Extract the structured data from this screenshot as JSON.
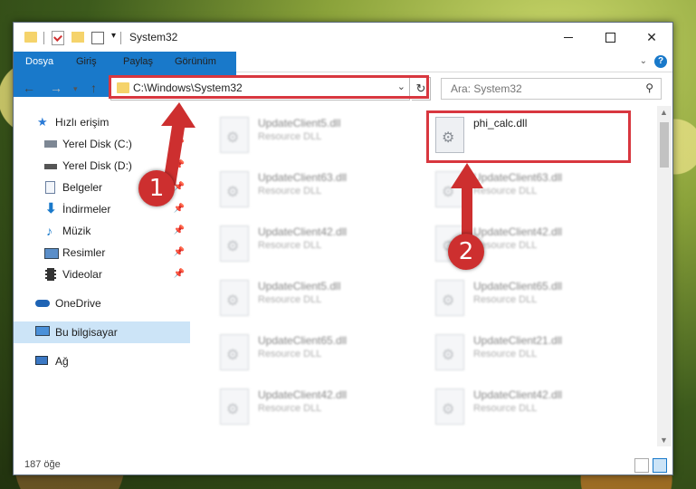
{
  "window": {
    "title": "System32"
  },
  "ribbon": {
    "tabs": [
      "Dosya",
      "Giriş",
      "Paylaş",
      "Görünüm"
    ],
    "help": "?"
  },
  "address": {
    "path": "C:\\Windows\\System32"
  },
  "search": {
    "placeholder": "Ara: System32"
  },
  "sidebar": {
    "items": [
      {
        "label": "Hızlı erişim",
        "icon": "star-icon"
      },
      {
        "label": "Yerel Disk (C:)",
        "icon": "drive-icon",
        "pinned": true
      },
      {
        "label": "Yerel Disk (D:)",
        "icon": "drive-icon",
        "pinned": true
      },
      {
        "label": "Belgeler",
        "icon": "document-icon",
        "pinned": true
      },
      {
        "label": "İndirmeler",
        "icon": "download-icon",
        "pinned": true
      },
      {
        "label": "Müzik",
        "icon": "music-icon",
        "pinned": true
      },
      {
        "label": "Resimler",
        "icon": "pictures-icon",
        "pinned": true
      },
      {
        "label": "Videolar",
        "icon": "videos-icon",
        "pinned": true
      },
      {
        "label": "OneDrive",
        "icon": "cloud-icon"
      },
      {
        "label": "Bu bilgisayar",
        "icon": "computer-icon",
        "selected": true
      },
      {
        "label": "Ağ",
        "icon": "network-icon"
      }
    ]
  },
  "files": {
    "left": [
      {
        "name": "UpdateClient5.dll",
        "type": "Resource DLL"
      },
      {
        "name": "UpdateClient63.dll",
        "type": "Resource DLL"
      },
      {
        "name": "UpdateClient42.dll",
        "type": "Resource DLL"
      },
      {
        "name": "UpdateClient5.dll",
        "type": "Resource DLL"
      },
      {
        "name": "UpdateClient65.dll",
        "type": "Resource DLL"
      },
      {
        "name": "UpdateClient42.dll",
        "type": "Resource DLL"
      }
    ],
    "right": [
      {
        "name": "phi_calc.dll",
        "type": ""
      },
      {
        "name": "UpdateClient63.dll",
        "type": "Resource DLL"
      },
      {
        "name": "UpdateClient42.dll",
        "type": "Resource DLL"
      },
      {
        "name": "UpdateClient65.dll",
        "type": "Resource DLL"
      },
      {
        "name": "UpdateClient21.dll",
        "type": "Resource DLL"
      },
      {
        "name": "UpdateClient42.dll",
        "type": "Resource DLL"
      }
    ]
  },
  "status": {
    "count": "187 öğe"
  },
  "callouts": {
    "one": "1",
    "two": "2"
  },
  "colors": {
    "accent": "#1979ca",
    "highlight": "#d8373f",
    "badge": "#cd2f2f"
  }
}
